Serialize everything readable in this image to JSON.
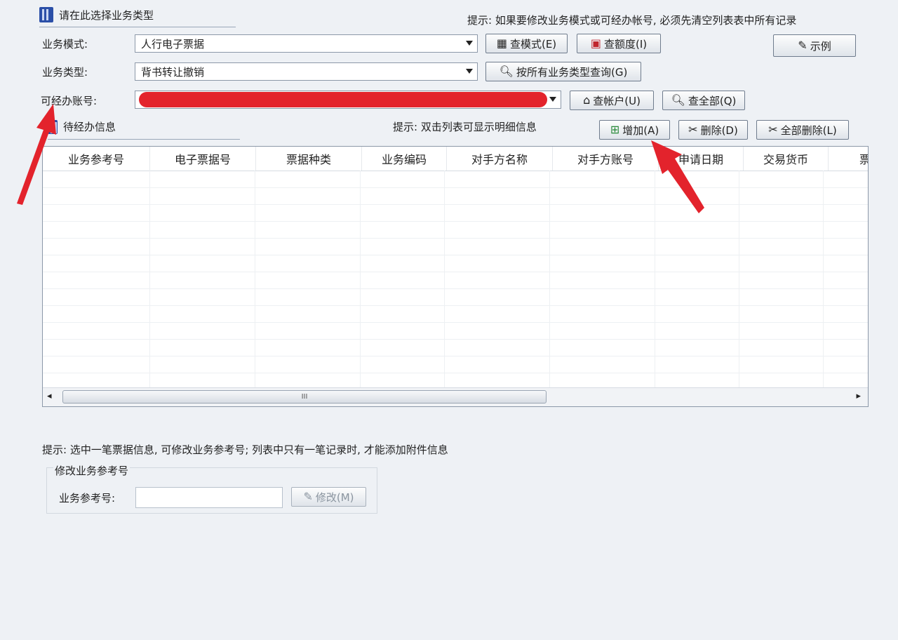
{
  "top_section": {
    "title": "请在此选择业务类型",
    "hint": "提示: 如果要修改业务模式或可经办帐号, 必须先清空列表表中所有记录"
  },
  "form": {
    "mode_label": "业务模式:",
    "mode_value": "人行电子票据",
    "type_label": "业务类型:",
    "type_value": "背书转让撤销",
    "account_label": "可经办账号:",
    "account_value": ""
  },
  "buttons": {
    "query_mode": "查模式(E)",
    "query_limit": "查额度(I)",
    "example": "示例",
    "query_by_type": "按所有业务类型查询(G)",
    "query_account": "查帐户(U)",
    "query_all": "查全部(Q)",
    "add": "增加(A)",
    "delete": "删除(D)",
    "delete_all": "全部删除(L)",
    "modify": "修改(M)"
  },
  "pending_section": {
    "title": "待经办信息",
    "hint": "提示: 双击列表可显示明细信息"
  },
  "table": {
    "columns": [
      "业务参考号",
      "电子票据号",
      "票据种类",
      "业务编码",
      "对手方名称",
      "对手方账号",
      "申请日期",
      "交易货币",
      "票"
    ],
    "rows": []
  },
  "scrollbar": {
    "left": "◂",
    "right": "▸",
    "thumb": "III"
  },
  "bottom": {
    "hint": "提示: 选中一笔票据信息, 可修改业务参考号; 列表中只有一笔记录时, 才能添加附件信息",
    "group_title": "修改业务参考号",
    "ref_label": "业务参考号:",
    "ref_value": ""
  },
  "colors": {
    "background": "#eef1f5",
    "annotation_arrow": "#e3232c",
    "redaction": "#e3232c"
  }
}
